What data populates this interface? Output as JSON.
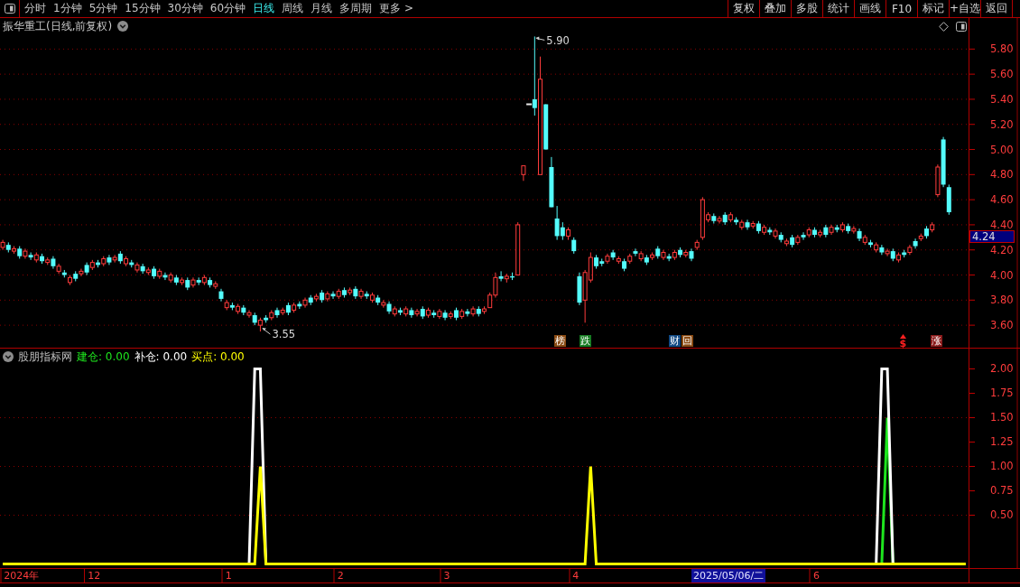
{
  "toolbar": {
    "period_tabs": [
      {
        "label": "分时",
        "selected": false
      },
      {
        "label": "1分钟",
        "selected": false
      },
      {
        "label": "5分钟",
        "selected": false
      },
      {
        "label": "15分钟",
        "selected": false
      },
      {
        "label": "30分钟",
        "selected": false
      },
      {
        "label": "60分钟",
        "selected": false
      },
      {
        "label": "日线",
        "selected": true
      },
      {
        "label": "周线",
        "selected": false
      },
      {
        "label": "月线",
        "selected": false
      },
      {
        "label": "多周期",
        "selected": false
      },
      {
        "label": "更多 >",
        "selected": false
      }
    ],
    "buttons": [
      "复权",
      "叠加",
      "多股",
      "统计",
      "画线",
      "F10",
      "标记",
      "+自选",
      "返回"
    ]
  },
  "main_chart": {
    "title": "振华重工(日线,前复权)",
    "price_labels": [
      {
        "label": "5.90",
        "kind": "high"
      },
      {
        "label": "3.55",
        "kind": "low"
      }
    ],
    "event_markers": [
      {
        "text": "榜",
        "kind": "badge",
        "color": "#8a4a12"
      },
      {
        "text": "跌",
        "kind": "badge",
        "color": "#167c22"
      },
      {
        "text": "财",
        "kind": "badge",
        "color": "#124a84"
      },
      {
        "text": "回",
        "kind": "badge",
        "color": "#8a4a12"
      },
      {
        "text": "$",
        "kind": "plain",
        "color": "#ff2020"
      },
      {
        "text": "涨",
        "kind": "badge",
        "color": "#8a1a1a"
      }
    ],
    "cursor_price": "4.24",
    "chart_data": {
      "type": "candlestick",
      "categories": [
        null,
        null,
        null,
        null,
        null,
        null,
        null,
        null,
        null,
        null,
        null,
        null,
        null,
        null,
        null,
        null,
        null,
        null,
        null,
        null,
        null,
        null,
        null,
        null,
        null,
        null,
        null,
        null,
        null,
        null,
        null,
        null,
        null,
        null,
        null,
        null,
        null,
        null,
        null,
        null,
        null,
        null,
        null,
        null,
        null,
        null,
        null,
        null,
        null,
        null,
        null,
        null,
        null,
        null,
        null,
        null,
        null,
        null,
        null,
        null,
        null,
        null,
        null,
        null,
        null,
        null,
        null,
        null,
        null,
        null,
        null,
        null,
        null,
        null,
        null,
        null,
        null,
        null,
        null,
        null,
        null,
        null,
        null,
        null,
        null,
        null,
        null,
        null,
        null,
        null,
        null,
        null,
        null,
        null,
        null,
        null,
        null,
        null,
        null,
        null,
        null,
        null,
        null,
        null,
        null,
        null,
        null,
        null,
        null,
        null,
        null,
        null,
        null,
        null,
        null,
        null,
        null,
        null,
        null,
        null,
        null,
        null,
        null,
        null,
        null,
        null,
        null,
        null,
        null,
        null,
        null,
        null,
        null,
        null,
        null,
        null,
        null,
        null,
        null,
        null,
        null,
        null,
        null,
        null,
        null,
        null,
        null,
        null,
        null,
        null,
        null,
        null,
        null,
        null,
        null,
        null,
        null,
        null,
        null,
        null,
        null,
        null,
        null,
        null,
        null,
        null,
        null,
        null,
        null,
        null,
        null,
        null,
        null
      ],
      "ohlc": [
        [
          4.22,
          4.28,
          4.2,
          4.26
        ],
        [
          4.24,
          4.26,
          4.18,
          4.2
        ],
        [
          4.19,
          4.23,
          4.17,
          4.21
        ],
        [
          4.21,
          4.23,
          4.13,
          4.15
        ],
        [
          4.15,
          4.21,
          4.13,
          4.19
        ],
        [
          4.16,
          4.18,
          4.12,
          4.14
        ],
        [
          4.12,
          4.18,
          4.1,
          4.16
        ],
        [
          4.15,
          4.17,
          4.09,
          4.11
        ],
        [
          4.1,
          4.14,
          4.08,
          4.12
        ],
        [
          4.13,
          4.15,
          4.05,
          4.07
        ],
        [
          4.03,
          4.09,
          4.01,
          4.07
        ],
        [
          4.02,
          4.04,
          3.98,
          4.0
        ],
        [
          3.94,
          4.0,
          3.92,
          3.98
        ],
        [
          4.01,
          4.03,
          3.95,
          3.97
        ],
        [
          4.01,
          4.05,
          3.99,
          4.03
        ],
        [
          4.08,
          4.1,
          4.0,
          4.02
        ],
        [
          4.06,
          4.12,
          4.04,
          4.1
        ],
        [
          4.1,
          4.12,
          4.06,
          4.08
        ],
        [
          4.09,
          4.15,
          4.07,
          4.13
        ],
        [
          4.14,
          4.16,
          4.08,
          4.1
        ],
        [
          4.12,
          4.16,
          4.1,
          4.14
        ],
        [
          4.17,
          4.19,
          4.09,
          4.11
        ],
        [
          4.09,
          4.15,
          4.07,
          4.13
        ],
        [
          4.1,
          4.12,
          4.06,
          4.08
        ],
        [
          4.04,
          4.1,
          4.02,
          4.08
        ],
        [
          4.07,
          4.09,
          4.01,
          4.03
        ],
        [
          4.02,
          4.06,
          4.0,
          4.04
        ],
        [
          4.05,
          4.07,
          3.97,
          3.99
        ],
        [
          3.99,
          4.05,
          3.97,
          4.03
        ],
        [
          4.0,
          4.02,
          3.96,
          3.98
        ],
        [
          3.96,
          4.02,
          3.94,
          4.0
        ],
        [
          3.98,
          4.0,
          3.92,
          3.94
        ],
        [
          3.94,
          3.98,
          3.92,
          3.96
        ],
        [
          3.96,
          3.98,
          3.88,
          3.9
        ],
        [
          3.92,
          3.98,
          3.9,
          3.96
        ],
        [
          3.96,
          3.98,
          3.92,
          3.94
        ],
        [
          3.94,
          4.0,
          3.92,
          3.98
        ],
        [
          3.96,
          3.98,
          3.9,
          3.92
        ],
        [
          3.91,
          3.95,
          3.89,
          3.93
        ],
        [
          3.87,
          3.89,
          3.79,
          3.81
        ],
        [
          3.74,
          3.8,
          3.72,
          3.78
        ],
        [
          3.76,
          3.78,
          3.72,
          3.74
        ],
        [
          3.71,
          3.77,
          3.69,
          3.75
        ],
        [
          3.74,
          3.76,
          3.68,
          3.7
        ],
        [
          3.68,
          3.72,
          3.66,
          3.7
        ],
        [
          3.68,
          3.7,
          3.6,
          3.62
        ],
        [
          3.6,
          3.66,
          3.55,
          3.64
        ],
        [
          3.66,
          3.68,
          3.62,
          3.64
        ],
        [
          3.66,
          3.72,
          3.64,
          3.7
        ],
        [
          3.72,
          3.74,
          3.66,
          3.68
        ],
        [
          3.7,
          3.74,
          3.68,
          3.72
        ],
        [
          3.76,
          3.78,
          3.68,
          3.7
        ],
        [
          3.72,
          3.78,
          3.7,
          3.76
        ],
        [
          3.77,
          3.79,
          3.73,
          3.75
        ],
        [
          3.76,
          3.82,
          3.74,
          3.8
        ],
        [
          3.82,
          3.84,
          3.76,
          3.78
        ],
        [
          3.81,
          3.85,
          3.79,
          3.83
        ],
        [
          3.86,
          3.88,
          3.78,
          3.8
        ],
        [
          3.81,
          3.87,
          3.79,
          3.85
        ],
        [
          3.85,
          3.87,
          3.81,
          3.83
        ],
        [
          3.83,
          3.89,
          3.81,
          3.87
        ],
        [
          3.88,
          3.9,
          3.82,
          3.84
        ],
        [
          3.86,
          3.9,
          3.84,
          3.88
        ],
        [
          3.89,
          3.91,
          3.81,
          3.83
        ],
        [
          3.83,
          3.89,
          3.81,
          3.87
        ],
        [
          3.85,
          3.87,
          3.81,
          3.83
        ],
        [
          3.8,
          3.86,
          3.78,
          3.84
        ],
        [
          3.82,
          3.84,
          3.76,
          3.78
        ],
        [
          3.76,
          3.8,
          3.74,
          3.78
        ],
        [
          3.77,
          3.79,
          3.69,
          3.71
        ],
        [
          3.69,
          3.75,
          3.67,
          3.73
        ],
        [
          3.72,
          3.74,
          3.68,
          3.7
        ],
        [
          3.69,
          3.75,
          3.67,
          3.73
        ],
        [
          3.72,
          3.74,
          3.66,
          3.68
        ],
        [
          3.69,
          3.73,
          3.67,
          3.71
        ],
        [
          3.73,
          3.75,
          3.65,
          3.67
        ],
        [
          3.68,
          3.74,
          3.66,
          3.72
        ],
        [
          3.7,
          3.72,
          3.66,
          3.68
        ],
        [
          3.67,
          3.73,
          3.65,
          3.71
        ],
        [
          3.7,
          3.72,
          3.64,
          3.66
        ],
        [
          3.67,
          3.71,
          3.65,
          3.69
        ],
        [
          3.72,
          3.74,
          3.64,
          3.66
        ],
        [
          3.67,
          3.73,
          3.65,
          3.71
        ],
        [
          3.71,
          3.73,
          3.67,
          3.69
        ],
        [
          3.69,
          3.75,
          3.67,
          3.73
        ],
        [
          3.73,
          3.75,
          3.67,
          3.69
        ],
        [
          3.71,
          3.75,
          3.69,
          3.73
        ],
        [
          3.74,
          3.86,
          3.74,
          3.84
        ],
        [
          3.84,
          4.02,
          3.82,
          3.98
        ],
        [
          3.99,
          4.03,
          3.95,
          3.97
        ],
        [
          3.97,
          4.01,
          3.94,
          3.99
        ],
        [
          3.99,
          4.02,
          3.96,
          3.98
        ],
        [
          4.0,
          4.42,
          4.0,
          4.4
        ],
        [
          4.8,
          4.87,
          4.75,
          4.87
        ],
        [
          5.36,
          5.36,
          5.36,
          5.36
        ],
        [
          5.4,
          5.9,
          5.27,
          5.33
        ],
        [
          4.8,
          5.74,
          4.8,
          5.56
        ],
        [
          5.36,
          5.36,
          5.0,
          5.0
        ],
        [
          4.86,
          4.94,
          4.54,
          4.54
        ],
        [
          4.45,
          4.55,
          4.28,
          4.31
        ],
        [
          4.38,
          4.42,
          4.28,
          4.31
        ],
        [
          4.31,
          4.38,
          4.28,
          4.36
        ],
        [
          4.28,
          4.3,
          4.17,
          4.19
        ],
        [
          3.99,
          4.02,
          3.76,
          3.78
        ],
        [
          3.8,
          4.04,
          3.62,
          4.02
        ],
        [
          3.96,
          4.18,
          3.94,
          4.14
        ],
        [
          4.14,
          4.16,
          4.05,
          4.07
        ],
        [
          4.11,
          4.13,
          4.07,
          4.09
        ],
        [
          4.11,
          4.17,
          4.09,
          4.15
        ],
        [
          4.18,
          4.2,
          4.12,
          4.14
        ],
        [
          4.11,
          4.15,
          4.09,
          4.13
        ],
        [
          4.11,
          4.13,
          4.03,
          4.05
        ],
        [
          4.11,
          4.17,
          4.09,
          4.15
        ],
        [
          4.19,
          4.21,
          4.15,
          4.17
        ],
        [
          4.13,
          4.19,
          4.11,
          4.17
        ],
        [
          4.14,
          4.16,
          4.08,
          4.1
        ],
        [
          4.14,
          4.18,
          4.12,
          4.16
        ],
        [
          4.21,
          4.23,
          4.13,
          4.15
        ],
        [
          4.14,
          4.2,
          4.12,
          4.18
        ],
        [
          4.15,
          4.17,
          4.11,
          4.13
        ],
        [
          4.14,
          4.2,
          4.12,
          4.18
        ],
        [
          4.2,
          4.22,
          4.14,
          4.16
        ],
        [
          4.16,
          4.2,
          4.14,
          4.18
        ],
        [
          4.19,
          4.21,
          4.11,
          4.13
        ],
        [
          4.22,
          4.28,
          4.2,
          4.26
        ],
        [
          4.3,
          4.62,
          4.28,
          4.6
        ],
        [
          4.44,
          4.5,
          4.42,
          4.48
        ],
        [
          4.47,
          4.49,
          4.41,
          4.43
        ],
        [
          4.43,
          4.47,
          4.41,
          4.45
        ],
        [
          4.48,
          4.5,
          4.4,
          4.42
        ],
        [
          4.44,
          4.5,
          4.42,
          4.48
        ],
        [
          4.44,
          4.46,
          4.4,
          4.42
        ],
        [
          4.38,
          4.44,
          4.36,
          4.42
        ],
        [
          4.42,
          4.44,
          4.36,
          4.38
        ],
        [
          4.39,
          4.43,
          4.37,
          4.41
        ],
        [
          4.41,
          4.43,
          4.33,
          4.35
        ],
        [
          4.34,
          4.4,
          4.32,
          4.38
        ],
        [
          4.36,
          4.38,
          4.32,
          4.34
        ],
        [
          4.31,
          4.37,
          4.29,
          4.35
        ],
        [
          4.32,
          4.34,
          4.26,
          4.28
        ],
        [
          4.25,
          4.29,
          4.23,
          4.27
        ],
        [
          4.3,
          4.32,
          4.22,
          4.24
        ],
        [
          4.26,
          4.32,
          4.24,
          4.3
        ],
        [
          4.32,
          4.34,
          4.28,
          4.3
        ],
        [
          4.32,
          4.38,
          4.3,
          4.36
        ],
        [
          4.36,
          4.38,
          4.3,
          4.32
        ],
        [
          4.32,
          4.36,
          4.3,
          4.34
        ],
        [
          4.38,
          4.4,
          4.3,
          4.32
        ],
        [
          4.34,
          4.4,
          4.32,
          4.38
        ],
        [
          4.38,
          4.4,
          4.34,
          4.36
        ],
        [
          4.36,
          4.42,
          4.34,
          4.4
        ],
        [
          4.39,
          4.41,
          4.33,
          4.35
        ],
        [
          4.35,
          4.39,
          4.33,
          4.37
        ],
        [
          4.35,
          4.37,
          4.27,
          4.29
        ],
        [
          4.26,
          4.32,
          4.24,
          4.3
        ],
        [
          4.26,
          4.28,
          4.22,
          4.24
        ],
        [
          4.2,
          4.26,
          4.18,
          4.24
        ],
        [
          4.22,
          4.24,
          4.16,
          4.18
        ],
        [
          4.17,
          4.21,
          4.15,
          4.19
        ],
        [
          4.19,
          4.21,
          4.11,
          4.13
        ],
        [
          4.12,
          4.18,
          4.1,
          4.16
        ],
        [
          4.18,
          4.2,
          4.14,
          4.16
        ],
        [
          4.18,
          4.24,
          4.16,
          4.22
        ],
        [
          4.27,
          4.29,
          4.21,
          4.23
        ],
        [
          4.29,
          4.33,
          4.27,
          4.31
        ],
        [
          4.37,
          4.39,
          4.29,
          4.31
        ],
        [
          4.36,
          4.42,
          4.34,
          4.4
        ],
        [
          4.64,
          4.88,
          4.62,
          4.86
        ],
        [
          5.08,
          5.1,
          4.7,
          4.72
        ],
        [
          4.7,
          4.72,
          4.48,
          4.5
        ],
        null,
        null,
        null
      ],
      "ylim": [
        3.421,
        6.047
      ],
      "grid": true,
      "yticks": [
        {
          "value": 5.8,
          "label": "5.80"
        },
        {
          "value": 5.6,
          "label": "5.60"
        },
        {
          "value": 5.4,
          "label": "5.40"
        },
        {
          "value": 5.2,
          "label": "5.20"
        },
        {
          "value": 5.0,
          "label": "5.00"
        },
        {
          "value": 4.8,
          "label": "4.80"
        },
        {
          "value": 4.6,
          "label": "4.60"
        },
        {
          "value": 4.4,
          "label": "4.40"
        },
        {
          "value": 4.2,
          "label": "4.20"
        },
        {
          "value": 4.0,
          "label": "4.00"
        },
        {
          "value": 3.8,
          "label": "3.80"
        },
        {
          "value": 3.6,
          "label": "3.60"
        }
      ]
    }
  },
  "indicator": {
    "title": "股朋指标网",
    "legend": [
      {
        "value": "0.00"
      },
      {
        "value": "0.00"
      },
      {
        "value": "0.00"
      }
    ],
    "chart_data": {
      "type": "line",
      "categories": [
        null,
        null,
        null,
        "2024年",
        null,
        null,
        null,
        null,
        null,
        null,
        null,
        null,
        null,
        null,
        null,
        null,
        "12",
        null,
        null,
        null,
        null,
        null,
        null,
        null,
        null,
        null,
        null,
        null,
        null,
        null,
        null,
        null,
        null,
        null,
        null,
        null,
        null,
        null,
        null,
        null,
        "1",
        null,
        null,
        null,
        null,
        null,
        null,
        null,
        null,
        null,
        null,
        null,
        null,
        null,
        null,
        null,
        null,
        null,
        null,
        null,
        "2",
        null,
        null,
        null,
        null,
        null,
        null,
        null,
        null,
        null,
        null,
        null,
        null,
        null,
        null,
        null,
        null,
        null,
        null,
        "3",
        null,
        null,
        null,
        null,
        null,
        null,
        null,
        null,
        null,
        null,
        null,
        null,
        null,
        null,
        null,
        null,
        null,
        null,
        null,
        null,
        null,
        null,
        "4",
        null,
        null,
        null,
        null,
        null,
        null,
        null,
        null,
        null,
        null,
        null,
        null,
        null,
        null,
        null,
        null,
        null,
        null,
        null,
        null,
        null,
        null,
        null,
        null,
        null,
        null,
        null,
        null,
        null,
        null,
        null,
        null,
        null,
        null,
        null,
        null,
        null,
        null,
        null,
        null,
        null,
        null,
        "6",
        null,
        null,
        null,
        null,
        null,
        null,
        null,
        null,
        null,
        null,
        null,
        null,
        null,
        null,
        null,
        null,
        null,
        null,
        null,
        null,
        null,
        null,
        null,
        null,
        null,
        null,
        null
      ],
      "series": [
        {
          "name": "建仓:",
          "color": "#1ee61e",
          "values": [
            null,
            null,
            null,
            null,
            null,
            null,
            null,
            null,
            null,
            null,
            null,
            null,
            null,
            null,
            null,
            null,
            null,
            null,
            null,
            null,
            null,
            null,
            null,
            null,
            null,
            null,
            null,
            null,
            null,
            null,
            null,
            null,
            null,
            null,
            null,
            null,
            null,
            null,
            null,
            null,
            null,
            null,
            null,
            null,
            null,
            null,
            null,
            null,
            null,
            null,
            null,
            null,
            null,
            null,
            null,
            null,
            null,
            null,
            null,
            null,
            null,
            null,
            null,
            null,
            null,
            null,
            null,
            null,
            null,
            null,
            null,
            null,
            null,
            null,
            null,
            null,
            null,
            null,
            null,
            null,
            null,
            null,
            null,
            null,
            null,
            null,
            null,
            null,
            null,
            null,
            null,
            null,
            null,
            null,
            null,
            null,
            null,
            null,
            null,
            null,
            null,
            null,
            null,
            null,
            null,
            null,
            null,
            null,
            null,
            null,
            null,
            null,
            null,
            null,
            null,
            null,
            null,
            null,
            null,
            null,
            null,
            null,
            null,
            null,
            null,
            null,
            null,
            null,
            null,
            null,
            null,
            null,
            null,
            null,
            null,
            null,
            null,
            null,
            null,
            null,
            null,
            null,
            null,
            null,
            null,
            null,
            null,
            null,
            null,
            null,
            null,
            null,
            null,
            null,
            null,
            null,
            null,
            0,
            1.5,
            0,
            null,
            null,
            null,
            null,
            null,
            null,
            null,
            null,
            null,
            null,
            null,
            null,
            null
          ]
        },
        {
          "name": "补仓:",
          "color": "#ffffff",
          "values": [
            null,
            null,
            null,
            null,
            null,
            null,
            null,
            null,
            null,
            null,
            null,
            null,
            null,
            null,
            null,
            null,
            null,
            null,
            null,
            null,
            null,
            null,
            null,
            null,
            null,
            null,
            null,
            null,
            null,
            null,
            null,
            null,
            null,
            null,
            null,
            null,
            null,
            null,
            null,
            null,
            null,
            null,
            null,
            null,
            0,
            2,
            2,
            0,
            null,
            null,
            null,
            null,
            null,
            null,
            null,
            null,
            null,
            null,
            null,
            null,
            null,
            null,
            null,
            null,
            null,
            null,
            null,
            null,
            null,
            null,
            null,
            null,
            null,
            null,
            null,
            null,
            null,
            null,
            null,
            null,
            null,
            null,
            null,
            null,
            null,
            null,
            null,
            null,
            null,
            null,
            null,
            null,
            null,
            null,
            null,
            null,
            null,
            null,
            null,
            null,
            null,
            null,
            null,
            null,
            null,
            null,
            null,
            null,
            null,
            null,
            null,
            null,
            null,
            null,
            null,
            null,
            null,
            null,
            null,
            null,
            null,
            null,
            null,
            null,
            null,
            null,
            null,
            null,
            null,
            null,
            null,
            null,
            null,
            null,
            null,
            null,
            null,
            null,
            null,
            null,
            null,
            null,
            null,
            null,
            null,
            null,
            null,
            null,
            null,
            null,
            null,
            null,
            null,
            null,
            null,
            null,
            0,
            2,
            2,
            0,
            null,
            null,
            null,
            null,
            null,
            null,
            null,
            null,
            null,
            null,
            null,
            null,
            null
          ]
        },
        {
          "name": "买点:",
          "color": "#ffff00",
          "values": [
            0,
            0,
            0,
            0,
            0,
            0,
            0,
            0,
            0,
            0,
            0,
            0,
            0,
            0,
            0,
            0,
            0,
            0,
            0,
            0,
            0,
            0,
            0,
            0,
            0,
            0,
            0,
            0,
            0,
            0,
            0,
            0,
            0,
            0,
            0,
            0,
            0,
            0,
            0,
            0,
            0,
            0,
            0,
            0,
            0,
            0,
            1,
            0,
            0,
            0,
            0,
            0,
            0,
            0,
            0,
            0,
            0,
            0,
            0,
            0,
            0,
            0,
            0,
            0,
            0,
            0,
            0,
            0,
            0,
            0,
            0,
            0,
            0,
            0,
            0,
            0,
            0,
            0,
            0,
            0,
            0,
            0,
            0,
            0,
            0,
            0,
            0,
            0,
            0,
            0,
            0,
            0,
            0,
            0,
            0,
            0,
            0,
            0,
            0,
            0,
            0,
            0,
            0,
            0,
            0,
            1,
            0,
            0,
            0,
            0,
            0,
            0,
            0,
            0,
            0,
            0,
            0,
            0,
            0,
            0,
            0,
            0,
            0,
            0,
            0,
            0,
            0,
            0,
            0,
            0,
            0,
            0,
            0,
            0,
            0,
            0,
            0,
            0,
            0,
            0,
            0,
            0,
            0,
            0,
            0,
            0,
            0,
            0,
            0,
            0,
            0,
            0,
            0,
            0,
            0,
            0,
            0,
            0,
            0,
            0,
            0,
            0,
            0,
            0,
            0,
            0,
            0,
            0,
            0,
            0,
            0,
            0,
            0
          ]
        }
      ],
      "ylim": [
        -0.0417,
        2.2083
      ],
      "grid": true,
      "yticks": [
        {
          "value": 2,
          "label": "2.00"
        },
        {
          "value": 1.75,
          "label": "1.75"
        },
        {
          "value": 1.5,
          "label": "1.50"
        },
        {
          "value": 1.25,
          "label": "1.25"
        },
        {
          "value": 1,
          "label": "1.00"
        },
        {
          "value": 0.75,
          "label": "0.75"
        },
        {
          "value": 0.5,
          "label": "0.50"
        }
      ]
    }
  },
  "time_axis": {
    "cursor_date": "2025/05/06/二"
  }
}
